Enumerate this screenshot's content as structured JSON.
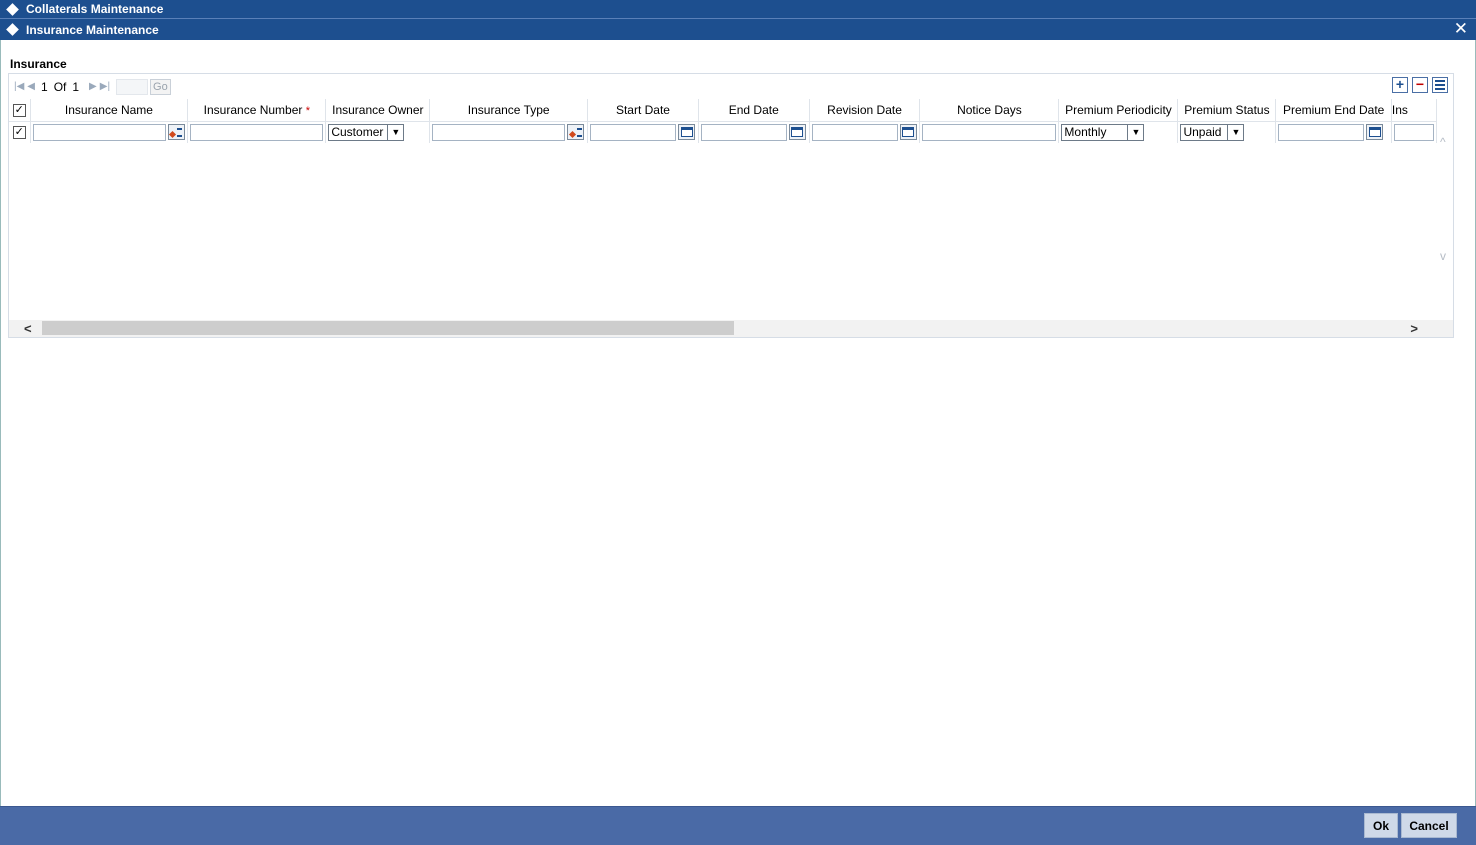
{
  "outer_window": {
    "title": "Collaterals Maintenance"
  },
  "dialog": {
    "title": "Insurance Maintenance",
    "close_glyph": "✕"
  },
  "section": {
    "title": "Insurance"
  },
  "pager": {
    "current": "1",
    "of_label": "Of",
    "total": "1",
    "go_label": "Go",
    "first_glyph": "|◀",
    "prev_glyph": "◀",
    "next_glyph": "▶",
    "last_glyph": "▶|"
  },
  "grid": {
    "columns": [
      {
        "label": "Insurance Name",
        "required": false
      },
      {
        "label": "Insurance Number",
        "required": true
      },
      {
        "label": "Insurance Owner",
        "required": false
      },
      {
        "label": "Insurance Type",
        "required": false
      },
      {
        "label": "Start Date",
        "required": false
      },
      {
        "label": "End Date",
        "required": false
      },
      {
        "label": "Revision Date",
        "required": false
      },
      {
        "label": "Notice Days",
        "required": false
      },
      {
        "label": "Premium Periodicity",
        "required": false
      },
      {
        "label": "Premium Status",
        "required": false
      },
      {
        "label": "Premium End Date",
        "required": false
      },
      {
        "label": "Ins",
        "required": false
      }
    ],
    "required_marker": "*",
    "rows": [
      {
        "checked": true,
        "insurance_name": "",
        "insurance_number": "",
        "insurance_owner": "Customer",
        "insurance_type": "",
        "start_date": "",
        "end_date": "",
        "revision_date": "",
        "notice_days": "",
        "premium_periodicity": "Monthly",
        "premium_status": "Unpaid",
        "premium_end_date": "",
        "ins": ""
      }
    ]
  },
  "icons": {
    "add": "plus-icon",
    "remove": "minus-icon",
    "view": "list-icon",
    "lov": "lov-icon",
    "calendar": "calendar-icon",
    "check": "✓",
    "dropdown": "▼",
    "scroll_left": "<",
    "scroll_right": ">",
    "scroll_up": "^",
    "scroll_down": "v"
  },
  "footer": {
    "ok_label": "Ok",
    "cancel_label": "Cancel"
  }
}
